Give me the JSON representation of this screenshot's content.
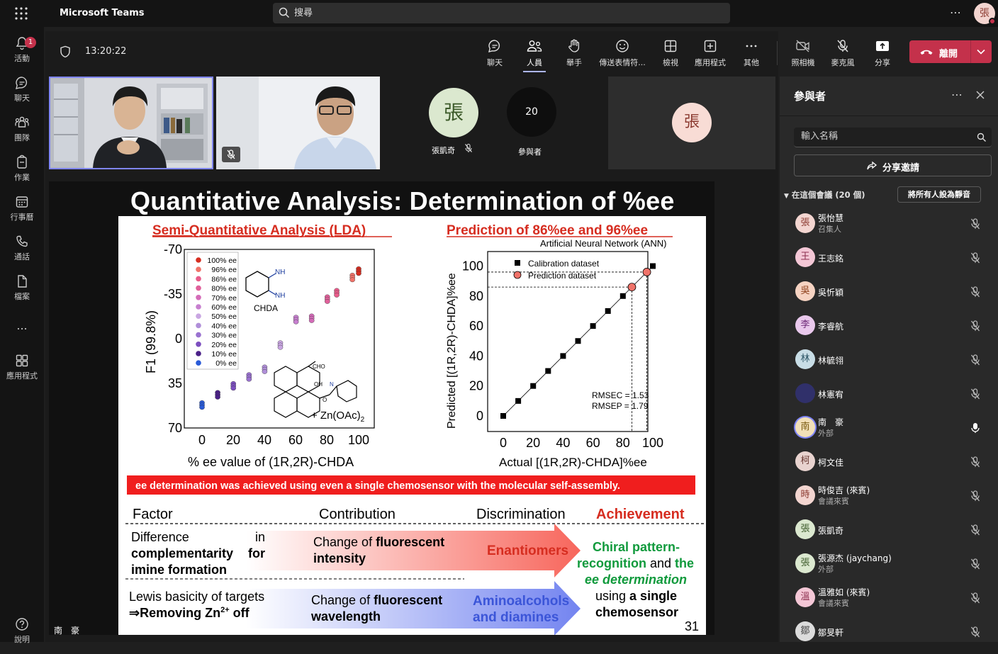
{
  "app": {
    "title": "Microsoft Teams"
  },
  "search": {
    "placeholder": "搜尋"
  },
  "user_avatar": "張",
  "rail": [
    {
      "label": "活動",
      "icon": "bell-icon",
      "badge": "1"
    },
    {
      "label": "聊天",
      "icon": "chat-icon"
    },
    {
      "label": "團隊",
      "icon": "teams-icon"
    },
    {
      "label": "作業",
      "icon": "assignments-icon"
    },
    {
      "label": "行事曆",
      "icon": "calendar-icon"
    },
    {
      "label": "通話",
      "icon": "call-icon"
    },
    {
      "label": "檔案",
      "icon": "file-icon"
    },
    {
      "label": "...",
      "icon": "more-icon"
    },
    {
      "label": "應用程式",
      "icon": "apps-icon"
    }
  ],
  "meeting": {
    "time": "13:20:22",
    "toolbar": {
      "chat": "聊天",
      "people": "人員",
      "raise_hand": "舉手",
      "reactions": "傳送表情符...",
      "view": "檢視",
      "apps": "應用程式",
      "more": "其他",
      "camera": "照相機",
      "mic": "麥克風",
      "share": "分享",
      "leave": "離開"
    },
    "tiles": {
      "avatar1_initial": "張",
      "avatar1_name": "張凱奇",
      "participants_count": "20",
      "participants_label": "參與者",
      "avatar2_initial": "張"
    },
    "presenter_name": "南　豪"
  },
  "slide": {
    "title": "Quantitative Analysis: Determination of %ee",
    "left_heading": "Semi-Quantitative Analysis (LDA)",
    "right_heading": "Prediction of 86%ee and 96%ee",
    "ann_label": "Artificial Neural Network (ANN)",
    "left_chart": {
      "ylabel": "F1 (99.8%)",
      "xlabel": "% ee value of (1R,2R)-CHDA",
      "xticks": [
        "0",
        "20",
        "40",
        "60",
        "80",
        "100"
      ],
      "yticks": [
        "-70",
        "-35",
        "0",
        "35",
        "70"
      ],
      "legend": [
        "100% ee",
        "96% ee",
        "86% ee",
        "80% ee",
        "70% ee",
        "60% ee",
        "50% ee",
        "40% ee",
        "30% ee",
        "20% ee",
        "10% ee",
        "0% ee"
      ],
      "legend_colors": [
        "#d62d20",
        "#f0736a",
        "#e85c8a",
        "#e0609a",
        "#d46bb8",
        "#c77fcf",
        "#c9a6e2",
        "#b08fd9",
        "#9a72d0",
        "#7c4fbf",
        "#4a2088",
        "#2a5bd8"
      ],
      "chda_label": "CHDA",
      "nh2_label": "NH",
      "cho_label": "CHO",
      "oh_label": "OH",
      "n_label": "N",
      "o_label": "O",
      "zn_label": "+ Zn(OAc)",
      "zn_sub": "2"
    },
    "right_chart": {
      "ylabel": "Predicted [(1R,2R)-CHDA]%ee",
      "xlabel": "Actual [(1R,2R)-CHDA]%ee",
      "xticks": [
        "0",
        "20",
        "40",
        "60",
        "80",
        "100"
      ],
      "yticks": [
        "0",
        "20",
        "40",
        "60",
        "80",
        "100"
      ],
      "legend_calibration": "Calibration dataset",
      "legend_prediction": "Prediction dataset",
      "rmsec": "RMSEC = 1.53",
      "rmsep": "RMSEP = 1.79"
    },
    "banner": "ee determination was achieved using even a single chemosensor with the molecular self-assembly.",
    "table": {
      "h_factor": "Factor",
      "h_contribution": "Contribution",
      "h_discrimination": "Discrimination",
      "h_achievement": "Achievement",
      "r1_factor_a": "Difference",
      "r1_factor_in": "in",
      "r1_factor_b": "complementarity",
      "r1_factor_for": "for",
      "r1_factor_c": "imine formation",
      "r1_contrib_a": "Change of ",
      "r1_contrib_b": "fluorescent",
      "r1_contrib_c": "intensity",
      "r1_disc": "Enantiomers",
      "r2_factor_a": "Lewis basicity of targets",
      "r2_factor_b": "⇒Removing Zn",
      "r2_factor_sup": "2+",
      "r2_factor_c": " off",
      "r2_contrib_a": "Change of ",
      "r2_contrib_b": "fluorescent",
      "r2_contrib_c": "wavelength",
      "r2_disc_a": "Aminoalcohols",
      "r2_disc_b": "and diamines",
      "ach_1": "Chiral pattern-",
      "ach_2": "recognition",
      "ach_and": " and ",
      "ach_the": "the",
      "ach_3": "ee determination",
      "ach_4a": "using ",
      "ach_4b": "a single",
      "ach_5": "chemosensor"
    },
    "page_number": "31"
  },
  "pane": {
    "title": "參與者",
    "name_placeholder": "輸入名稱",
    "share_invite": "分享邀請",
    "in_meeting": "在這個會議 (20 個)",
    "mute_all": "將所有人設為靜音",
    "participants": [
      {
        "initial": "張",
        "name": "張怡慧",
        "sub": "召集人",
        "bg": "#f3d5d0",
        "fg": "#8b3a30",
        "mic": "muted"
      },
      {
        "initial": "王",
        "name": "王志銘",
        "sub": "",
        "bg": "#f4c7d6",
        "fg": "#8b2d4d",
        "mic": "muted"
      },
      {
        "initial": "吳",
        "name": "吳忻穎",
        "sub": "",
        "bg": "#f6d3c2",
        "fg": "#8c3e18",
        "mic": "muted"
      },
      {
        "initial": "李",
        "name": "李睿航",
        "sub": "",
        "bg": "#e9c8ec",
        "fg": "#6e2a78",
        "mic": "muted"
      },
      {
        "initial": "林",
        "name": "林毓翎",
        "sub": "",
        "bg": "#c8dde6",
        "fg": "#2c5566",
        "mic": "muted"
      },
      {
        "initial": "",
        "name": "林憲宥",
        "sub": "",
        "bg": "#30306a",
        "fg": "#fff",
        "mic": "muted"
      },
      {
        "initial": "南",
        "name": "南　豪",
        "sub": "外部",
        "bg": "#f2e0b8",
        "fg": "#7a5a10",
        "mic": "on"
      },
      {
        "initial": "柯",
        "name": "柯文佳",
        "sub": "",
        "bg": "#e8d3cf",
        "fg": "#6a3a33",
        "mic": "muted"
      },
      {
        "initial": "時",
        "name": "時俊吉 (來賓)",
        "sub": "會議來賓",
        "bg": "#f3d5d0",
        "fg": "#8b3a30",
        "mic": "muted"
      },
      {
        "initial": "張",
        "name": "張凱奇",
        "sub": "",
        "bg": "#dbe8cf",
        "fg": "#3c5a2a",
        "mic": "muted"
      },
      {
        "initial": "張",
        "name": "張源杰 (jaychang)",
        "sub": "外部",
        "bg": "#dbe8cf",
        "fg": "#3c5a2a",
        "mic": "muted"
      },
      {
        "initial": "溫",
        "name": "溫雅如 (來賓)",
        "sub": "會議來賓",
        "bg": "#f4c7d6",
        "fg": "#8b2d4d",
        "mic": "muted"
      },
      {
        "initial": "鄒",
        "name": "鄒旻軒",
        "sub": "",
        "bg": "#dcdcdc",
        "fg": "#444",
        "mic": "muted"
      }
    ]
  }
}
